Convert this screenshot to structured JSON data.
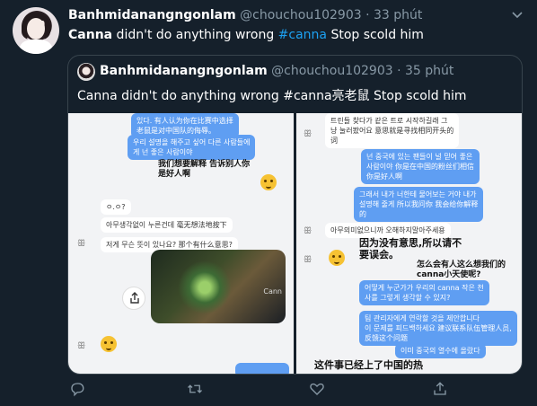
{
  "tweet": {
    "display_name": "Banhmidanangngonlam",
    "handle": "@chouchou102903",
    "separator": "·",
    "time": "33 phút",
    "text_part1": "Canna",
    "text_part2": " didn't do anything wrong ",
    "hashtag": "#canna",
    "text_part3": " Stop scold him",
    "more_icon": "chevron-down-icon"
  },
  "quoted": {
    "display_name": "Banhmidanangngonlam",
    "handle": "@chouchou102903",
    "separator": "·",
    "time": "35 phút",
    "text": "Canna didn't do anything wrong #canna亮老鼠 Stop scold him"
  },
  "shot_left": {
    "b1_line1": "있다.  有人认为你在比赛中选择",
    "b1_line2": "老鼠是对中国队的侮辱。",
    "b2_line1": "우리 설명을 해주고 싶어 다른 사람들에",
    "b2_line2": "게 넌 좋은 사람이야",
    "cn1_line1": "我们想要解释 告诉别人你",
    "cn1_line2": "是好人啊",
    "b3": "ㅇ.ㅇ?",
    "b4_line1": "아무생각없이 누른건데 毫无想法地按下",
    "b5_line1": "저게 무슨 뜻이 있나요?  那个有什么意思?",
    "img_label": "Cann"
  },
  "shot_right": {
    "r1_line1": "트린들 찾다가 같은 트로 시작하길래 그",
    "r1_line2": "냥 눌러봤어요  意思就是寻找相同开头的",
    "r1_line3": "词",
    "r2_line1": "넌 중국에 있는 팬들이 널 믿어 좋은",
    "r2_line2": "사람이야  你是在中国的粉丝们相信",
    "r2_line3": "你是好人啊",
    "r3_line1": "그래서 내가 너한테 물어보는 거야 내가",
    "r3_line2": "설명해 줄게 所以我问你 我会给你解释",
    "r3_line3": "的",
    "r4": "아무의미없으니까 오해하지말아주세용",
    "r5_line1": "因为没有意思,所以请不",
    "r5_line2": "要误会。",
    "r6_line1": "怎么会有人这么想我们的",
    "r6_line2": "canna小天使呢?",
    "r7_line1": "어떻게 누군가가 우리의 canna 작은 천",
    "r7_line2": "사를 그렇게 생각할 수 있지?",
    "r8_line1": "팀 관리자에게 연락할 것을 제안합니다",
    "r8_line2": "이 문제를 피드백하세요  建议联系队伍管理人员,",
    "r8_line3": "反馈这个问题",
    "r9": "이미 중국의 열수에 올랐다",
    "r10": "这件事已经上了中国的热"
  },
  "actions": {
    "reply_icon": "reply-icon",
    "retweet_icon": "retweet-icon",
    "like_icon": "heart-icon",
    "share_icon": "share-icon"
  },
  "colors": {
    "background": "#15202b",
    "accent": "#1da1f2",
    "muted": "#8899a6",
    "border": "#38444d",
    "bubble_blue": "#5f9ef2"
  }
}
